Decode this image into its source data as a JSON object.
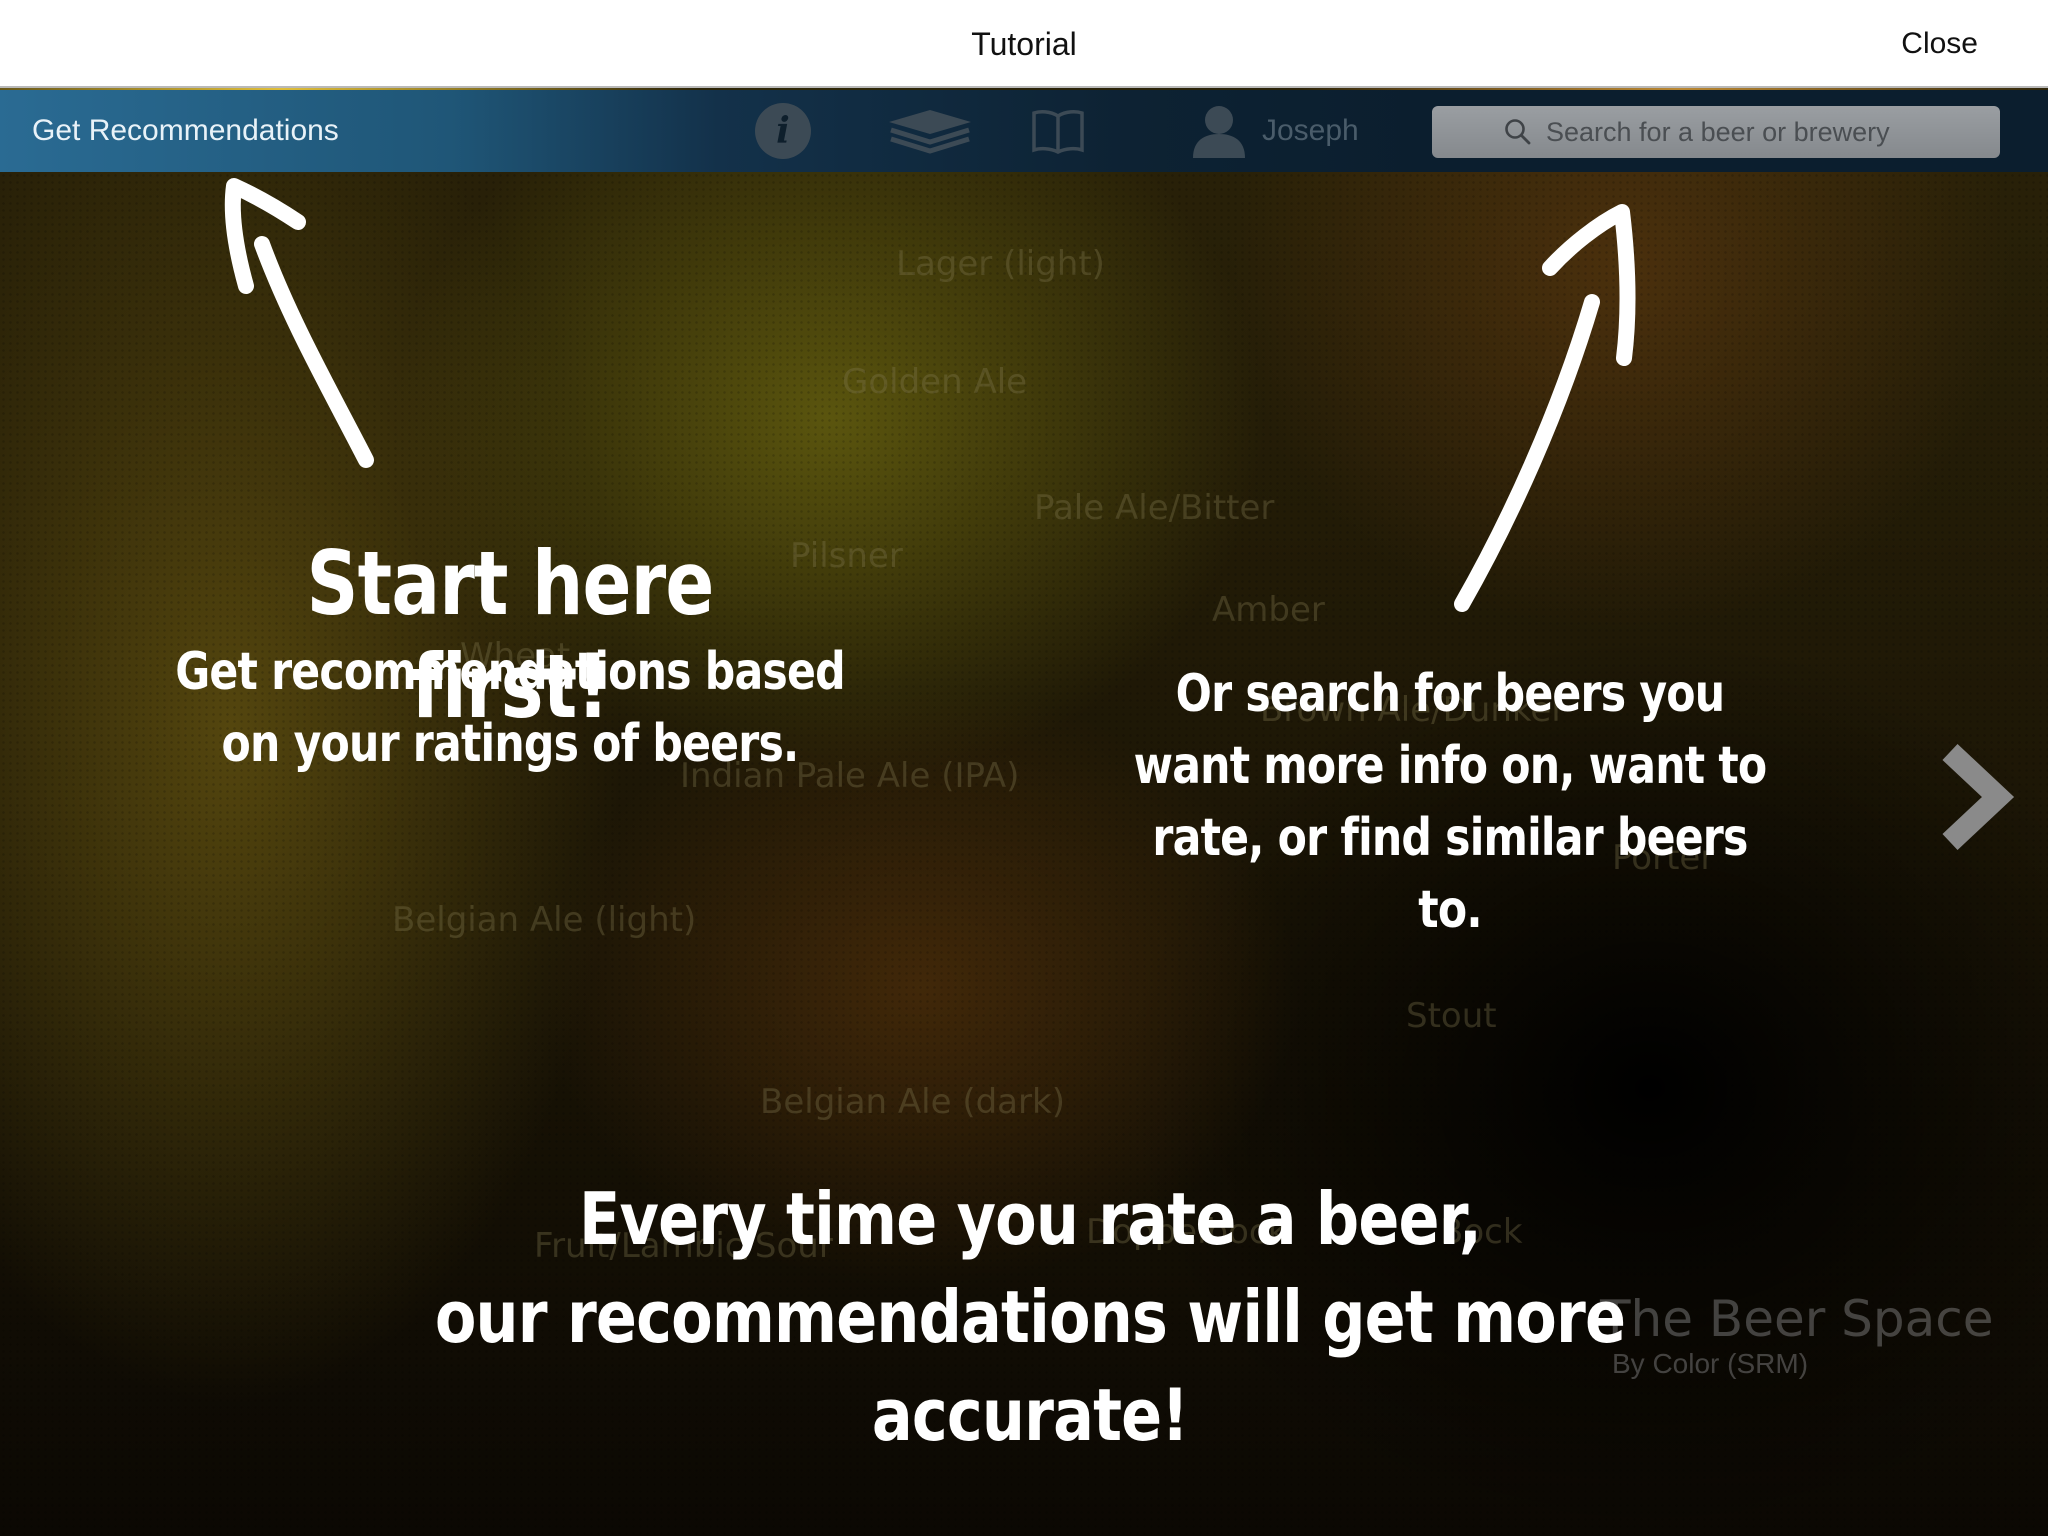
{
  "modal": {
    "title": "Tutorial",
    "close_label": "Close"
  },
  "navbar": {
    "recommendations_label": "Get Recommendations",
    "info_icon": "info-icon",
    "layers_icon": "layers-icon",
    "book_icon": "book-icon",
    "user_icon": "user-icon",
    "user_name": "Joseph",
    "search_placeholder": "Search for a beer or brewery"
  },
  "background": {
    "style_labels": [
      "Lager (light)",
      "Golden Ale",
      "Pale Ale/Bitter",
      "Pilsner",
      "Amber",
      "Wheat",
      "Brown Ale/Dunkel",
      "Indian Pale Ale (IPA)",
      "Porter",
      "Belgian Ale (light)",
      "Stout",
      "Belgian Ale (dark)",
      "Fruit/Lambic/Sour",
      "Bock",
      "Doppelbock"
    ],
    "brand_title": "The Beer Space",
    "brand_subtitle": "By Color (SRM)"
  },
  "tutorial": {
    "headline": "Start here first!",
    "left_description": "Get recommendations based on your ratings of beers.",
    "right_description": "Or search for beers you want more info on, want to rate, or find similar beers to.",
    "bottom_line1": "Every time you rate a beer,",
    "bottom_line2": "our recommendations will get more accurate!"
  },
  "colors": {
    "navbar_left": "#2a6b93",
    "navbar_right": "#0b1e2e",
    "overlay_text": "#ffffff"
  }
}
